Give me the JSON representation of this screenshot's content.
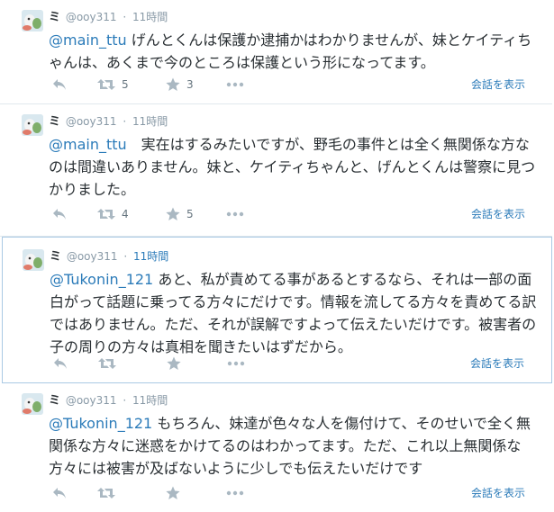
{
  "tweets": [
    {
      "name": "ミ",
      "handle": "@ooy311",
      "separator": "·",
      "time": "11時間",
      "mention": "@main_ttu",
      "body": " げんとくんは保護か逮捕かはわかりませんが、妹とケイティちゃんは、あくまで今のところは保護という形になってます。",
      "retweets": "5",
      "favorites": "3",
      "conversation_label": "会話を表示"
    },
    {
      "name": "ミ",
      "handle": "@ooy311",
      "separator": "·",
      "time": "11時間",
      "mention": "@main_ttu",
      "body": "　実在はするみたいですが、野毛の事件とは全く無関係な方なのは間違いありません。妹と、ケイティちゃんと、げんとくんは警察に見つかりました。",
      "retweets": "4",
      "favorites": "5",
      "conversation_label": "会話を表示"
    },
    {
      "name": "ミ",
      "handle": "@ooy311",
      "separator": "·",
      "time": "11時間",
      "mention": "@Tukonin_121",
      "body": " あと、私が責めてる事があるとするなら、それは一部の面白がって話題に乗ってる方々にだけです。情報を流してる方々を責めてる訳ではありません。ただ、それが誤解ですよって伝えたいだけです。被害者の子の周りの方々は真相を聞きたいはずだから。",
      "retweets": "",
      "favorites": "",
      "conversation_label": "会話を表示"
    },
    {
      "name": "ミ",
      "handle": "@ooy311",
      "separator": "·",
      "time": "11時間",
      "mention": "@Tukonin_121",
      "body": " もちろん、妹達が色々な人を傷付けて、そのせいで全く無関係な方々に迷惑をかけてるのはわかってます。ただ、これ以上無関係な方々には被害が及ばないように少しでも伝えたいだけです",
      "retweets": "",
      "favorites": "",
      "conversation_label": "会話を表示"
    }
  ],
  "icons": {
    "reply": "reply-icon",
    "retweet": "retweet-icon",
    "favorite": "star-icon",
    "more": "more-dots-icon"
  },
  "colors": {
    "link": "#2b7bb9",
    "action_gray": "#aab8c2",
    "highlight_border": "#a9c9e4"
  }
}
